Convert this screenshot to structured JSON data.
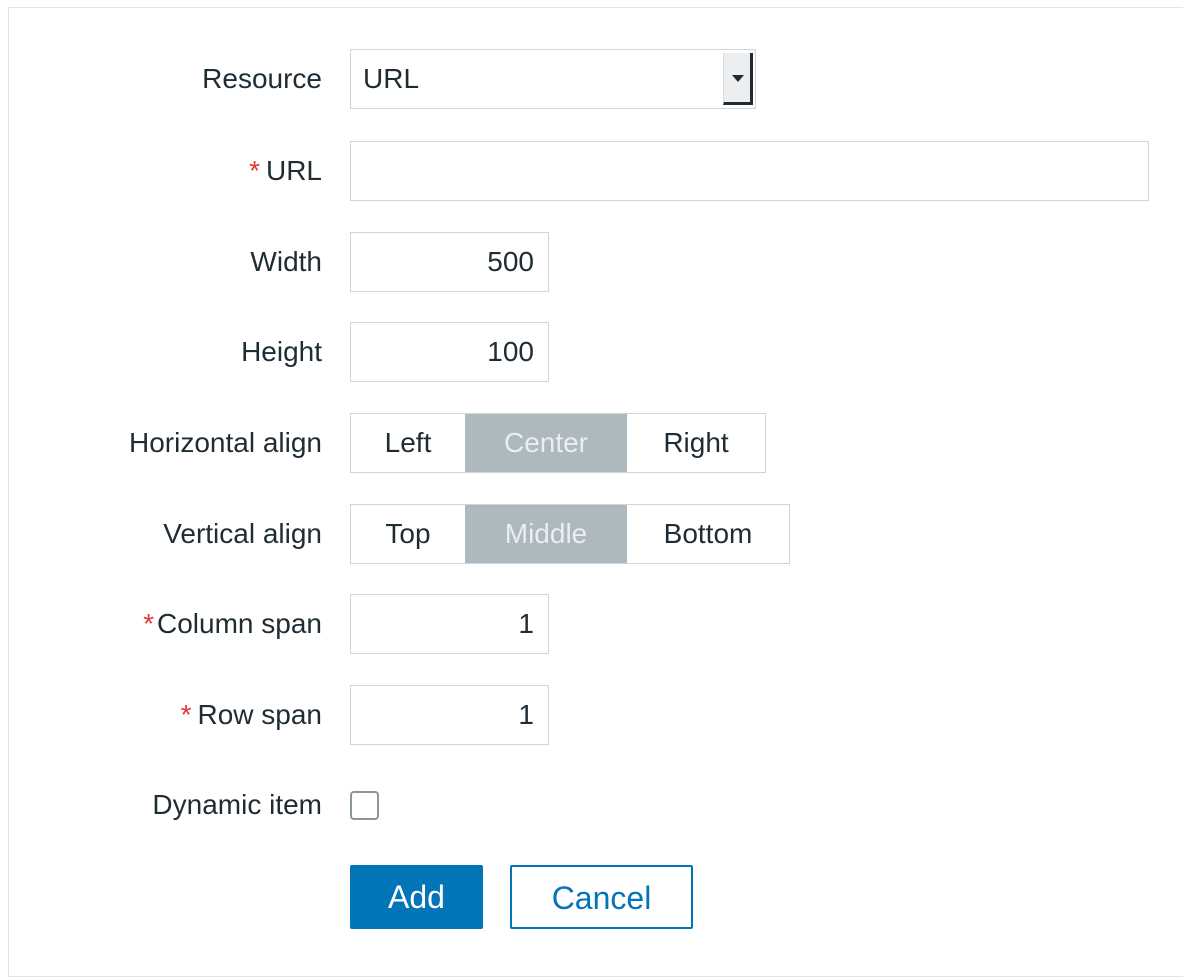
{
  "form": {
    "resource": {
      "label": "Resource",
      "value": "URL"
    },
    "url": {
      "label": "URL",
      "required_mark": "*",
      "value": "",
      "placeholder": ""
    },
    "width": {
      "label": "Width",
      "value": "500"
    },
    "height": {
      "label": "Height",
      "value": "100"
    },
    "horizontal_align": {
      "label": "Horizontal align",
      "options": [
        "Left",
        "Center",
        "Right"
      ],
      "selected": "Center"
    },
    "vertical_align": {
      "label": "Vertical align",
      "options": [
        "Top",
        "Middle",
        "Bottom"
      ],
      "selected": "Middle"
    },
    "column_span": {
      "label": "Column span",
      "required_mark": "*",
      "value": "1"
    },
    "row_span": {
      "label": "Row span",
      "required_mark": "*",
      "value": "1"
    },
    "dynamic_item": {
      "label": "Dynamic item",
      "checked": false
    }
  },
  "buttons": {
    "add_label": "Add",
    "cancel_label": "Cancel"
  },
  "colors": {
    "primary": "#0275b8",
    "required": "#e33734",
    "selected_segment": "#adb8bf"
  }
}
